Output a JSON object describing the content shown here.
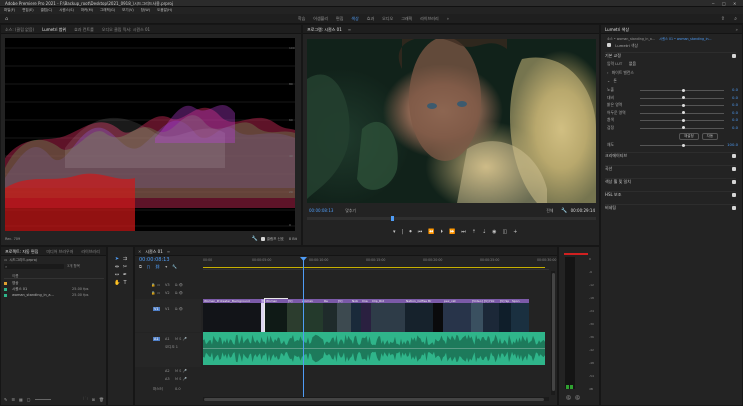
{
  "titlebar": {
    "title": "Adobe Premiere Pro 2021 - F:\\Backup_root\\Desktop\\2021_0918_\\시드그리드사용.prproj",
    "min": "─",
    "max": "□",
    "close": "✕"
  },
  "menu": [
    "파일(F)",
    "편집(E)",
    "클립(C)",
    "시퀀스(S)",
    "마커(M)",
    "그래픽(G)",
    "보기(V)",
    "창(W)",
    "도움말(H)"
  ],
  "workspaces": [
    "학습",
    "어셈블리",
    "편집",
    "색상",
    "효과",
    "오디오",
    "그래픽",
    "라이브러리"
  ],
  "workspace_active": "색상",
  "scopes": {
    "tabs": [
      "소스: (클립 없음)",
      "Lumetri 범위",
      "효과 컨트롤",
      "오디오 클립 믹서: 시퀀스 01"
    ],
    "active_tab": "Lumetri 범위",
    "scale_labels": [
      "100",
      "90",
      "80",
      "70",
      "60",
      "50",
      "40",
      "30",
      "20",
      "10",
      "0"
    ],
    "scale_unit": "Rec. 709",
    "footer_label": "8 Bit",
    "clamp_label": "클램프 신호"
  },
  "program": {
    "tabs": [
      "프로그램: 시퀀스 01"
    ],
    "timecode": "00:00:08:13",
    "fit": "맞추기",
    "quality": "전체",
    "duration": "00:00:29:14",
    "transport": [
      "⏵",
      "⏹",
      "⏮",
      "⏪",
      "⏵",
      "⏩",
      "⏭"
    ]
  },
  "lumetri": {
    "tabs": [
      "Lumetri 색상"
    ],
    "clip_source": "소스 • woman_standing_in_a...",
    "clip_target": "시퀀스 01 • woman_standing_in...",
    "preset_label": "Lumetri 색상",
    "sections": {
      "basic": "기본 교정",
      "input_lut_label": "입력 LUT",
      "input_lut_value": "없음",
      "white_balance": "화이트 밸런스",
      "tone": "톤",
      "creative": "크리에이티브",
      "curves": "곡선",
      "wheels": "색상 휠 및 일치",
      "hsl": "HSL 보조",
      "vignette": "비네팅"
    },
    "tone_rows": [
      {
        "label": "노출",
        "value": "0.0",
        "pos": 0.5
      },
      {
        "label": "대비",
        "value": "0.0",
        "pos": 0.5
      },
      {
        "label": "밝은 영역",
        "value": "0.0",
        "pos": 0.5
      },
      {
        "label": "어두운 영역",
        "value": "0.0",
        "pos": 0.5
      },
      {
        "label": "흰색",
        "value": "0.0",
        "pos": 0.5
      },
      {
        "label": "검정",
        "value": "0.0",
        "pos": 0.5
      }
    ],
    "reset_label": "재설정",
    "auto_label": "자동",
    "saturation_label": "채도",
    "saturation_value": "100.0"
  },
  "project": {
    "tabs": [
      "프로젝트: 자동 편집",
      "미디어 브라우저",
      "라이브러리"
    ],
    "project_file": "시드그리드.prproj",
    "count": "3개 항목",
    "search_placeholder": "",
    "col_name": "이름",
    "items": [
      {
        "name": "영상",
        "fps": "",
        "color": "#e0a030"
      },
      {
        "name": "시퀀스 01",
        "fps": "25.00 fps",
        "color": "#2fb58a"
      },
      {
        "name": "woman_standing_in_a...",
        "fps": "25.00 fps",
        "color": "#2fb58a"
      }
    ]
  },
  "timeline": {
    "tabs": [
      "시퀀스 01"
    ],
    "timecode": "00:00:08:13",
    "ruler": [
      "00:00",
      "00:00:05:00",
      "00:00:10:00",
      "00:00:15:00",
      "00:00:20:00",
      "00:00:25:00",
      "00:00:30:00"
    ],
    "video_tracks": [
      "V3",
      "V2",
      "V1"
    ],
    "audio_tracks": [
      "A1",
      "A2",
      "A3"
    ],
    "audio_track_name": "오디오 1",
    "master_label": "마스터",
    "master_value": "0.0",
    "clips": [
      {
        "label": "Women_Protester_Background",
        "color": "#7b5aa8",
        "thumb": "#121418"
      },
      {
        "label": "[V]",
        "color": "#a283d6",
        "thumb": "#dcd5ef"
      },
      {
        "label": "Woman",
        "color": "#7b5aa8",
        "thumb": "#0f1a16"
      },
      {
        "label": "[V]",
        "color": "#7b5aa8",
        "thumb": "#2c3d2e"
      },
      {
        "label": "woman",
        "color": "#7b5aa8",
        "thumb": "#243a2c"
      },
      {
        "label": "Re",
        "color": "#7b5aa8",
        "thumb": "#1f2b2b"
      },
      {
        "label": "[V]",
        "color": "#7b5aa8",
        "thumb": "#3d4a50"
      },
      {
        "label": "Nob",
        "color": "#7b5aa8",
        "thumb": "#1a2a3a"
      },
      {
        "label": "Ima",
        "color": "#7b5aa8",
        "thumb": "#2a2040"
      },
      {
        "label": "Clip_Rid",
        "color": "#7b5aa8",
        "thumb": "#2e3c48"
      },
      {
        "label": "Nation_Coffee Br",
        "color": "#7b5aa8",
        "thumb": "#16222c"
      },
      {
        "label": "",
        "color": "#7b5aa8",
        "thumb": "#0a0a0c"
      },
      {
        "label": "pex_cat",
        "color": "#7b5aa8",
        "thumb": "#28344a"
      },
      {
        "label": "[Video]",
        "color": "#7b5aa8",
        "thumb": "#3a5060"
      },
      {
        "label": "[V] Hol",
        "color": "#7b5aa8",
        "thumb": "#1c2838"
      },
      {
        "label": "[V] Sp",
        "color": "#7b5aa8",
        "thumb": "#0f1e2a"
      },
      {
        "label": "Spon",
        "color": "#7b5aa8",
        "thumb": "#1a3040"
      }
    ]
  },
  "meter": {
    "scale": [
      "0",
      "-6",
      "-12",
      "-18",
      "-24",
      "-30",
      "-36",
      "-42",
      "-48",
      "-54",
      "dB"
    ],
    "solo": [
      "S",
      "S"
    ]
  },
  "colors": {
    "accent": "#4f9cf5",
    "clip_video": "#7b5aa8",
    "clip_audio": "#2fb58a",
    "playhead": "#4f9cf5"
  }
}
